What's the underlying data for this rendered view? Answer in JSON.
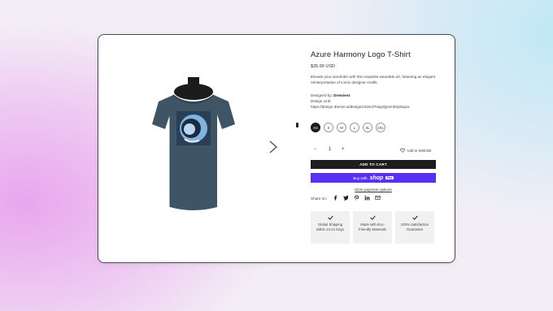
{
  "product": {
    "title": "Azure Harmony Logo T-Shirt",
    "price": "$35.99 USD",
    "description": "Elevate your wardrobe with this exquisite wearable art, featuring an elegant reinterpretation of iconic designer motifs.",
    "designed_by_label": "Designed by:",
    "designer": "DremieAI",
    "design_link_label": "Design Link:",
    "design_link_url": "https://design.dremie.ai/designs/42sol7hapyfgzemb0y5tq1w"
  },
  "sizes": {
    "options": [
      "XS",
      "S",
      "M",
      "L",
      "XL",
      "2XL"
    ],
    "selected": "XS"
  },
  "quantity": {
    "minus": "−",
    "value": "1",
    "plus": "+"
  },
  "wishlist": {
    "label": "Add to Wishlist",
    "icon": "heart-icon"
  },
  "buttons": {
    "add_to_cart": "ADD TO CART",
    "buy_with": "Buy with",
    "shop_brand": "shop",
    "pay_badge": "Pay",
    "more_payment": "More payment options"
  },
  "share": {
    "label": "Share on:",
    "icons": [
      "facebook-icon",
      "twitter-icon",
      "pinterest-icon",
      "linkedin-icon",
      "email-icon"
    ]
  },
  "badges": [
    {
      "icon": "check-icon",
      "text": "Global Shipping within 14-21 Days"
    },
    {
      "icon": "check-icon",
      "text": "Made with Eco-Friendly Materials"
    },
    {
      "icon": "check-icon",
      "text": "100% Satisfaction Guarantee"
    }
  ],
  "colors": {
    "shop_pay": "#5a31f4",
    "add_to_cart": "#1e1e1e",
    "shirt": "#3f5566"
  }
}
